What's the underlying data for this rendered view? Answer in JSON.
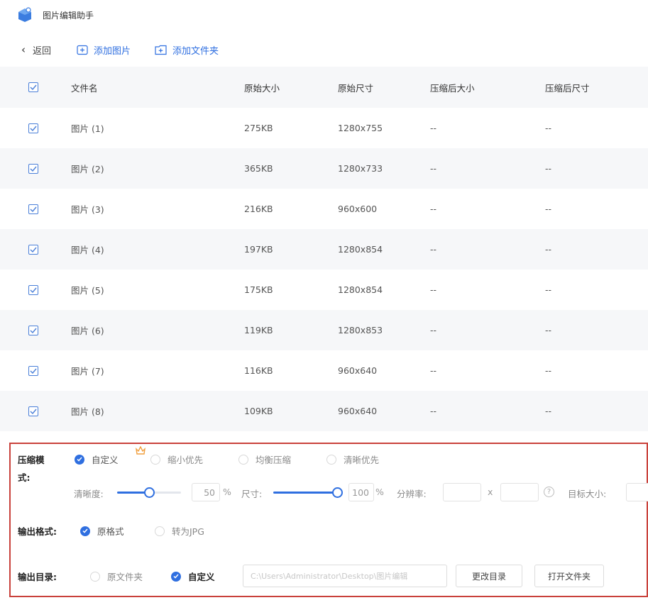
{
  "app": {
    "title": "图片编辑助手"
  },
  "toolbar": {
    "back_label": "返回",
    "add_image_label": "添加图片",
    "add_folder_label": "添加文件夹"
  },
  "table": {
    "headers": [
      "文件名",
      "原始大小",
      "原始尺寸",
      "压缩后大小",
      "压缩后尺寸"
    ],
    "rows": [
      {
        "name": "图片 (1)",
        "size": "275KB",
        "dim": "1280x755",
        "csize": "--",
        "cdim": "--"
      },
      {
        "name": "图片 (2)",
        "size": "365KB",
        "dim": "1280x733",
        "csize": "--",
        "cdim": "--"
      },
      {
        "name": "图片 (3)",
        "size": "216KB",
        "dim": "960x600",
        "csize": "--",
        "cdim": "--"
      },
      {
        "name": "图片 (4)",
        "size": "197KB",
        "dim": "1280x854",
        "csize": "--",
        "cdim": "--"
      },
      {
        "name": "图片 (5)",
        "size": "175KB",
        "dim": "1280x854",
        "csize": "--",
        "cdim": "--"
      },
      {
        "name": "图片 (6)",
        "size": "119KB",
        "dim": "1280x853",
        "csize": "--",
        "cdim": "--"
      },
      {
        "name": "图片 (7)",
        "size": "116KB",
        "dim": "960x640",
        "csize": "--",
        "cdim": "--"
      },
      {
        "name": "图片 (8)",
        "size": "109KB",
        "dim": "960x640",
        "csize": "--",
        "cdim": "--"
      }
    ]
  },
  "compress": {
    "label_line1": "压缩模",
    "label_line2": "式:",
    "modes": [
      "自定义",
      "缩小优先",
      "均衡压缩",
      "清晰优先"
    ],
    "selected_mode": "自定义",
    "clarity_label": "清晰度:",
    "clarity_value": 50,
    "clarity_text": "50",
    "size_label": "尺寸:",
    "size_value": 100,
    "size_text": "100",
    "percent": "%",
    "resolution_label": "分辨率:",
    "times": "x",
    "help": "?",
    "target_label": "目标大小:"
  },
  "format": {
    "label": "输出格式:",
    "options": [
      "原格式",
      "转为JPG"
    ],
    "selected": "原格式"
  },
  "output": {
    "label": "输出目录:",
    "options": [
      "原文件夹",
      "自定义"
    ],
    "selected": "自定义",
    "path": "C:\\Users\\Administrator\\Desktop\\图片编辑",
    "change_label": "更改目录",
    "open_label": "打开文件夹"
  },
  "colors": {
    "accent": "#2f6fe0",
    "highlight_border": "#c9413b",
    "row_alt": "#f6f7f9"
  }
}
